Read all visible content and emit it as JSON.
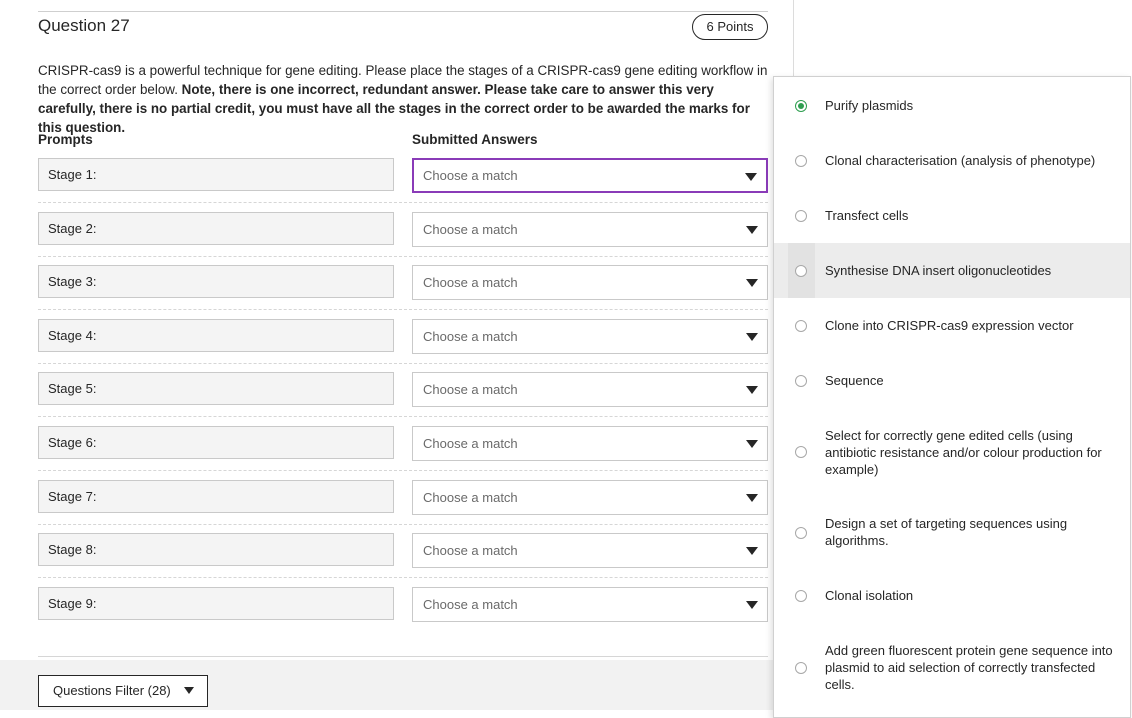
{
  "question": {
    "title": "Question 27",
    "points": "6 Points",
    "text_plain": "CRISPR-cas9 is a powerful technique for gene editing. Please place the stages of a CRISPR-cas9 gene editing workflow in the correct order below. ",
    "text_bold": "Note, there is one incorrect, redundant answer. Please take care to answer this very carefully, there is no partial credit, you must have all the stages in the correct order to be awarded the marks for this question."
  },
  "columns": {
    "prompts": "Prompts",
    "answers": "Submitted Answers"
  },
  "rows": [
    {
      "prompt": "Stage 1:",
      "answer": "Choose a match"
    },
    {
      "prompt": "Stage 2:",
      "answer": "Choose a match"
    },
    {
      "prompt": "Stage 3:",
      "answer": "Choose a match"
    },
    {
      "prompt": "Stage 4:",
      "answer": "Choose a match"
    },
    {
      "prompt": "Stage 5:",
      "answer": "Choose a match"
    },
    {
      "prompt": "Stage 6:",
      "answer": "Choose a match"
    },
    {
      "prompt": "Stage 7:",
      "answer": "Choose a match"
    },
    {
      "prompt": "Stage 8:",
      "answer": "Choose a match"
    },
    {
      "prompt": "Stage 9:",
      "answer": "Choose a match"
    }
  ],
  "footer": {
    "filter_label": "Questions Filter (28)"
  },
  "dropdown": {
    "options": [
      {
        "label": "Purify plasmids",
        "selected": true
      },
      {
        "label": "Clonal characterisation (analysis of phenotype)"
      },
      {
        "label": "Transfect cells"
      },
      {
        "label": "Synthesise DNA insert oligonucleotides",
        "hover": true
      },
      {
        "label": "Clone into CRISPR-cas9 expression vector"
      },
      {
        "label": "Sequence"
      },
      {
        "label": "Select for correctly gene edited cells (using antibiotic resistance and/or colour production for example)"
      },
      {
        "label": "Design a set of targeting sequences using algorithms."
      },
      {
        "label": "Clonal isolation"
      },
      {
        "label": "Add green fluorescent protein gene sequence into plasmid to aid selection of correctly transfected cells."
      }
    ]
  },
  "colors": {
    "focus": "#8a3bb8",
    "selected_radio": "#2e9e4f"
  }
}
